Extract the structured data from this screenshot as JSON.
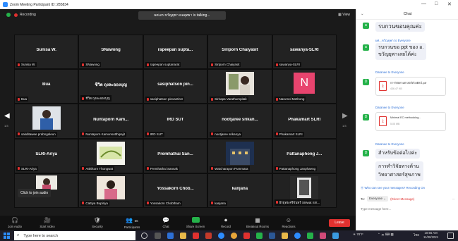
{
  "window": {
    "title": "Zoom Meeting Participant ID: 285834",
    "controls": [
      "—",
      "□",
      "✕"
    ]
  },
  "topbar": {
    "recording": "Recording",
    "talking": "ผศ.ดร.ขวัญยุพา ผลอุทธา is talking...",
    "view": "View"
  },
  "nav": {
    "page_left": "1/3",
    "page_right": "1/3"
  },
  "tiles": [
    {
      "name": "Sunisa W.",
      "label": "Sunisa W."
    },
    {
      "name": "SNawong",
      "label": "SNawong"
    },
    {
      "name": "rapeepan supta...",
      "label": "rapeepan suptanarat"
    },
    {
      "name": "Siriporn Chaiyasit",
      "label": "Siriporn Chaiyasit"
    },
    {
      "name": "sawanya-SLRI",
      "label": "sawanya-SLRI"
    },
    {
      "name": "Bua",
      "label": "Bua"
    },
    {
      "name": "ชีวิต ถุงละอองบุญ",
      "label": "ชีวิต ถุงละอองบุญ"
    },
    {
      "name": "sasiphatson pin...",
      "label": "sasiphatson pinvantirot"
    },
    {
      "name": "",
      "label": "Sirirapa Varathumpitak"
    },
    {
      "name": "N",
      "label": "Narumol Methong"
    },
    {
      "name": "",
      "label": "sakditawee prabngaleun"
    },
    {
      "name": "Nuntaporn Kam...",
      "label": "Nuntaporn Kamonsutthipajit"
    },
    {
      "name": "IRD SUT",
      "label": "IRD SUT"
    },
    {
      "name": "nootjaree srikan...",
      "label": "nootjaree srikanya"
    },
    {
      "name": "Phakamart SLRI",
      "label": "Phakamart SLRI"
    },
    {
      "name": "SLRI-Ariya",
      "label": "SLRI-Ariya"
    },
    {
      "name": "",
      "label": "Atthikorn Thongwat"
    },
    {
      "name": "Premhathai San...",
      "label": "Premhathai Sansak"
    },
    {
      "name": "",
      "label": "Watcharapon Pummara"
    },
    {
      "name": "Pattanaphong J...",
      "label": "Pattanaphong Janphaeng"
    },
    {
      "name": "",
      "label": ""
    },
    {
      "name": "",
      "label": "Cattiya Bupiriya"
    },
    {
      "name": "Yossakorn Chob...",
      "label": "Yossakorn Chobtham"
    },
    {
      "name": "kanjana",
      "label": "kanjana"
    },
    {
      "name": "",
      "label": "ธีรยุทธ ศรีจันทร์ Siriwat Srit..."
    }
  ],
  "join_tip": "Click to join audio",
  "controls": {
    "join_audio": "Join Audio",
    "start_video": "Start Video",
    "security": "Security",
    "participants": "Participants",
    "participants_count": "56",
    "chat": "Chat",
    "share": "Share Screen",
    "record": "Record",
    "breakout": "Breakout Rooms",
    "reactions": "Reactions",
    "leave": "Leave"
  },
  "chat": {
    "title": "Chat",
    "messages": [
      {
        "bubble": "รบกวนขอบคุณค่ะ"
      },
      {
        "from": "ผศ._ขวัญยุพา to Everyone",
        "bubble1": "รบกวนขอ ppt ของ อ.",
        "bubble2": "ขวัญยุพาเลยได้ค่ะ"
      },
      {
        "from": "Daranee to Everyone",
        "file": "การวิจัยทางศาสตร์ด้วยศิลป์.pdf",
        "size": "436.47 KB"
      },
      {
        "from": "Daranee to Everyone",
        "file": "Minimal EC methodolog...",
        "size": "5.05 MB"
      },
      {
        "from": "Daranee to Everyone",
        "bubble1": "สำหรับข้อต่อไปค่ะ",
        "bubble2": "การทำวิจัยทางด้าน",
        "bubble3": "วิทยาศาสตร์สุขภาพ"
      }
    ],
    "who_can_see": "Who can see your messages? Recording On",
    "to_label": "To:",
    "to_value": "Everyone",
    "direct": "(Direct Message)",
    "more": "···",
    "placeholder": "Type message here..."
  },
  "taskbar": {
    "search": "Type here to search",
    "weather": "78°F",
    "lang": "ไทย",
    "time": "10:56 AM",
    "date": "11/30/2021"
  }
}
